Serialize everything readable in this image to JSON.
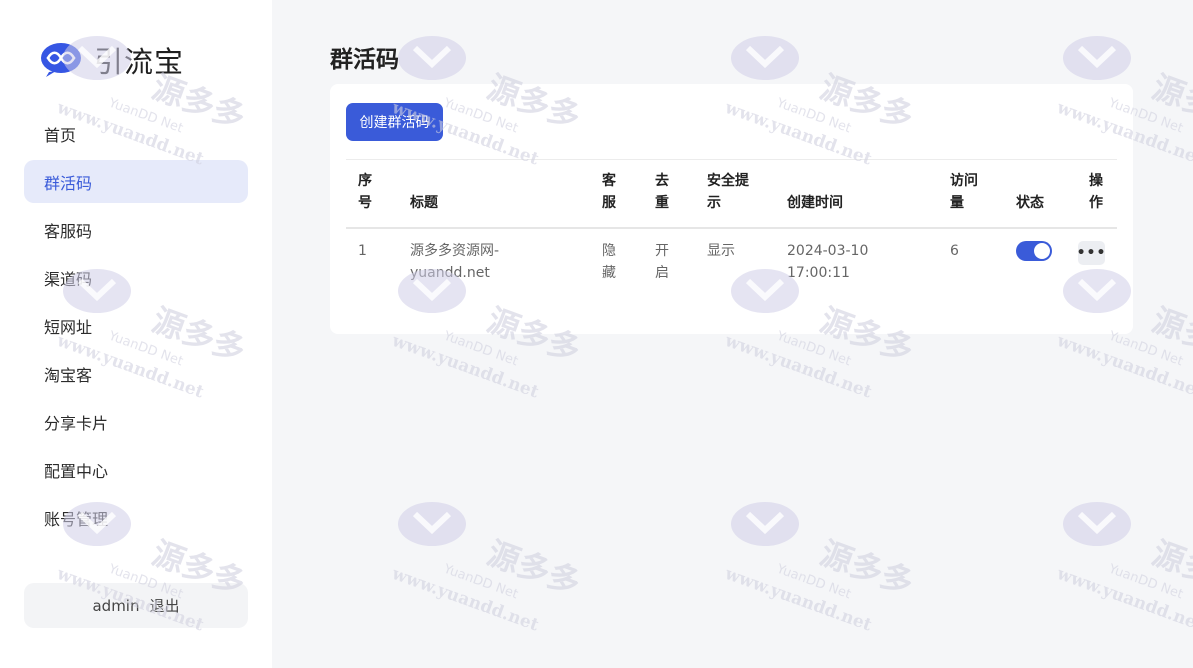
{
  "app": {
    "name": "引流宝"
  },
  "sidebar": {
    "items": [
      {
        "label": "首页",
        "active": false
      },
      {
        "label": "群活码",
        "active": true
      },
      {
        "label": "客服码",
        "active": false
      },
      {
        "label": "渠道码",
        "active": false
      },
      {
        "label": "短网址",
        "active": false
      },
      {
        "label": "淘宝客",
        "active": false
      },
      {
        "label": "分享卡片",
        "active": false
      },
      {
        "label": "配置中心",
        "active": false
      },
      {
        "label": "账号管理",
        "active": false
      }
    ],
    "user": {
      "name": "admin",
      "logout_label": "退出"
    }
  },
  "main": {
    "title": "群活码",
    "create_button_label": "创建群活码",
    "table": {
      "headers": {
        "index": [
          "序",
          "号"
        ],
        "title": "标题",
        "kefu": [
          "客",
          "服"
        ],
        "dedupe": [
          "去",
          "重"
        ],
        "safety_tip": [
          "安全提",
          "示"
        ],
        "created_time": "创建时间",
        "visits": [
          "访问",
          "量"
        ],
        "status": "状态",
        "actions": [
          "操",
          "作"
        ]
      },
      "rows": [
        {
          "index": "1",
          "title": [
            "源多多资源网-",
            "yuandd.net"
          ],
          "kefu": [
            "隐",
            "藏"
          ],
          "dedupe": [
            "开",
            "启"
          ],
          "safety_tip": "显示",
          "created_time": [
            "2024-03-10",
            "17:00:11"
          ],
          "visits": "6",
          "status_on": true,
          "actions_label": "•••"
        }
      ]
    }
  },
  "watermark": {
    "main_text": "源多多",
    "sub_text": "YuanDD Net",
    "url_text": "www.yuandd.net"
  },
  "colors": {
    "accent": "#3a5bd9",
    "active_bg": "#e6eafa",
    "logo_blue": "#3656e3"
  }
}
